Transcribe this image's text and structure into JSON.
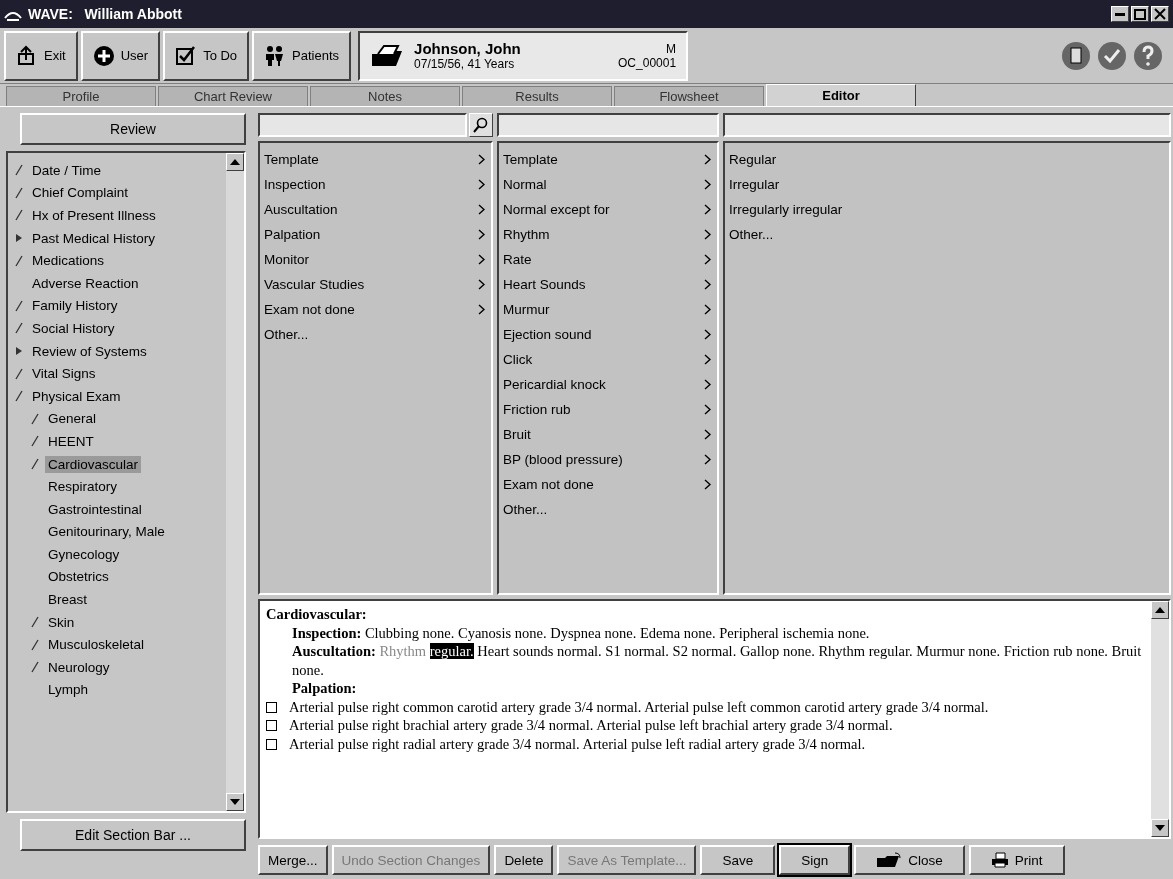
{
  "window": {
    "title": "WAVE:   William Abbott"
  },
  "toolbar": {
    "buttons": [
      {
        "kind": "exit",
        "label": "Exit"
      },
      {
        "kind": "user",
        "label": "User"
      },
      {
        "kind": "todo",
        "label": "To Do"
      },
      {
        "kind": "patients",
        "label": "Patients"
      }
    ],
    "patient": {
      "name": "Johnson, John",
      "dob_age": "07/15/56, 41 Years",
      "sex": "M",
      "id": "OC_00001"
    }
  },
  "tabs": [
    {
      "label": "Profile",
      "selected": false
    },
    {
      "label": "Chart Review",
      "selected": false
    },
    {
      "label": "Notes",
      "selected": false
    },
    {
      "label": "Results",
      "selected": false
    },
    {
      "label": "Flowsheet",
      "selected": false
    },
    {
      "label": "Editor",
      "selected": true
    }
  ],
  "sidebar": {
    "review_button": "Review",
    "edit_button": "Edit Section Bar ...",
    "items": [
      {
        "label": "Date / Time",
        "kind": "check",
        "selected": false
      },
      {
        "label": "Chief Complaint",
        "kind": "check",
        "selected": false
      },
      {
        "label": "Hx of Present Illness",
        "kind": "check",
        "selected": false
      },
      {
        "label": "Past Medical History",
        "kind": "arrow",
        "selected": false
      },
      {
        "label": "Medications",
        "kind": "check",
        "selected": false
      },
      {
        "label": "Adverse Reaction",
        "kind": "plain",
        "selected": false
      },
      {
        "label": "Family History",
        "kind": "check",
        "selected": false
      },
      {
        "label": "Social History",
        "kind": "check",
        "selected": false
      },
      {
        "label": "Review of Systems",
        "kind": "arrow",
        "selected": false
      },
      {
        "label": "Vital Signs",
        "kind": "check",
        "selected": false
      },
      {
        "label": "Physical Exam",
        "kind": "check",
        "selected": false,
        "children": [
          {
            "label": "General",
            "kind": "check",
            "selected": false
          },
          {
            "label": "HEENT",
            "kind": "check",
            "selected": false
          },
          {
            "label": "Cardiovascular",
            "kind": "check",
            "selected": true
          },
          {
            "label": "Respiratory",
            "kind": "plain",
            "selected": false
          },
          {
            "label": "Gastrointestinal",
            "kind": "plain",
            "selected": false
          },
          {
            "label": "Genitourinary, Male",
            "kind": "plain",
            "selected": false
          },
          {
            "label": "Gynecology",
            "kind": "plain",
            "selected": false
          },
          {
            "label": "Obstetrics",
            "kind": "plain",
            "selected": false
          },
          {
            "label": "Breast",
            "kind": "plain",
            "selected": false
          },
          {
            "label": "Skin",
            "kind": "check",
            "selected": false
          },
          {
            "label": "Musculoskeletal",
            "kind": "check",
            "selected": false
          },
          {
            "label": "Neurology",
            "kind": "check",
            "selected": false
          },
          {
            "label": "Lymph",
            "kind": "plain",
            "selected": false
          }
        ]
      }
    ]
  },
  "pick_columns": [
    {
      "searchable": true,
      "items": [
        {
          "label": "Template",
          "submenu": true
        },
        {
          "label": "Inspection",
          "submenu": true
        },
        {
          "label": "Auscultation",
          "submenu": true
        },
        {
          "label": "Palpation",
          "submenu": true
        },
        {
          "label": "Monitor",
          "submenu": true
        },
        {
          "label": "Vascular Studies",
          "submenu": true
        },
        {
          "label": "Exam not done",
          "submenu": true
        },
        {
          "label": "Other...",
          "submenu": false
        }
      ]
    },
    {
      "searchable": false,
      "items": [
        {
          "label": "Template",
          "submenu": true
        },
        {
          "label": "Normal",
          "submenu": true
        },
        {
          "label": "Normal except for",
          "submenu": true
        },
        {
          "label": "Rhythm",
          "submenu": true
        },
        {
          "label": "Rate",
          "submenu": true
        },
        {
          "label": "Heart Sounds",
          "submenu": true
        },
        {
          "label": "Murmur",
          "submenu": true
        },
        {
          "label": "Ejection sound",
          "submenu": true
        },
        {
          "label": "Click",
          "submenu": true
        },
        {
          "label": "Pericardial knock",
          "submenu": true
        },
        {
          "label": "Friction rub",
          "submenu": true
        },
        {
          "label": "Bruit",
          "submenu": true
        },
        {
          "label": "BP (blood pressure)",
          "submenu": true
        },
        {
          "label": "Exam not done",
          "submenu": true
        },
        {
          "label": "Other...",
          "submenu": false
        }
      ]
    },
    {
      "searchable": false,
      "items": [
        {
          "label": "Regular",
          "submenu": false
        },
        {
          "label": "Irregular",
          "submenu": false
        },
        {
          "label": "Irregularly irregular",
          "submenu": false
        },
        {
          "label": "Other...",
          "submenu": false
        }
      ]
    }
  ],
  "note": {
    "heading": "Cardiovascular:",
    "blocks": [
      {
        "kind": "para",
        "segments": [
          {
            "kind": "label",
            "text": "Inspection:"
          },
          {
            "kind": "plain",
            "text": "Clubbing none.  Cyanosis none.  Dyspnea none.  Edema none.  Peripheral ischemia none."
          }
        ]
      },
      {
        "kind": "para",
        "segments": [
          {
            "kind": "label",
            "text": "Auscultation:"
          },
          {
            "kind": "dim",
            "text": "Rhythm"
          },
          {
            "kind": "highlight",
            "text": "regular."
          },
          {
            "kind": "plain",
            "text": "Heart sounds normal.  S1 normal.  S2 normal.  Gallop none.  Rhythm regular.  Murmur none.  Friction rub none.  Bruit none."
          }
        ]
      },
      {
        "kind": "subhead",
        "text": "Palpation:"
      },
      {
        "kind": "check",
        "checked": false,
        "text": "Arterial pulse right common carotid artery grade 3/4 normal.  Arterial pulse left common carotid artery grade 3/4 normal."
      },
      {
        "kind": "check",
        "checked": false,
        "text": "Arterial pulse right brachial artery grade 3/4 normal.  Arterial pulse left brachial artery grade 3/4 normal."
      },
      {
        "kind": "check",
        "checked": false,
        "text": "Arterial pulse right radial artery grade 3/4 normal.  Arterial pulse left radial artery grade 3/4 normal."
      }
    ]
  },
  "actions": [
    {
      "label": "Merge...",
      "kind": "text",
      "disabled": false,
      "default": false
    },
    {
      "label": "Undo Section Changes",
      "kind": "text",
      "disabled": true,
      "default": false
    },
    {
      "label": "Delete",
      "kind": "text",
      "disabled": false,
      "default": false
    },
    {
      "label": "Save As Template...",
      "kind": "text",
      "disabled": true,
      "default": false
    },
    {
      "label": "Save",
      "kind": "text",
      "disabled": false,
      "default": false
    },
    {
      "label": "Sign",
      "kind": "text",
      "disabled": false,
      "default": true
    },
    {
      "label": "Close",
      "kind": "close",
      "disabled": false,
      "default": false
    },
    {
      "label": "Print",
      "kind": "print",
      "disabled": false,
      "default": false
    }
  ]
}
